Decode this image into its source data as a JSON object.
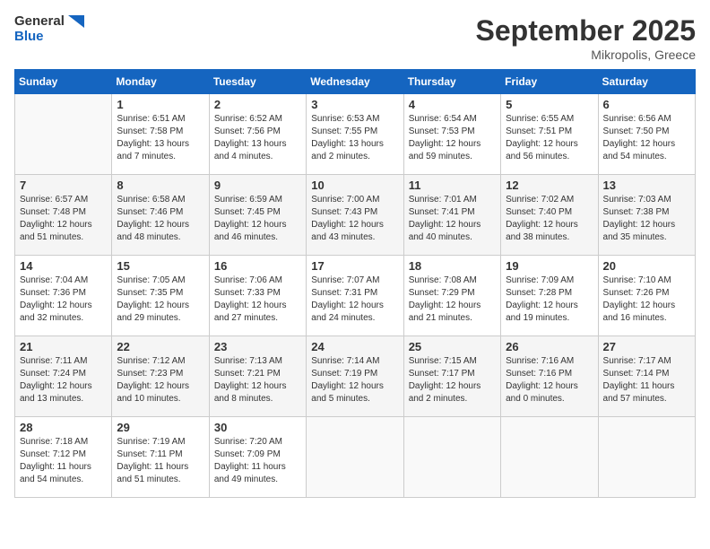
{
  "header": {
    "logo_line1": "General",
    "logo_line2": "Blue",
    "month": "September 2025",
    "location": "Mikropolis, Greece"
  },
  "days_of_week": [
    "Sunday",
    "Monday",
    "Tuesday",
    "Wednesday",
    "Thursday",
    "Friday",
    "Saturday"
  ],
  "weeks": [
    [
      {
        "day": "",
        "sunrise": "",
        "sunset": "",
        "daylight": ""
      },
      {
        "day": "1",
        "sunrise": "Sunrise: 6:51 AM",
        "sunset": "Sunset: 7:58 PM",
        "daylight": "Daylight: 13 hours and 7 minutes."
      },
      {
        "day": "2",
        "sunrise": "Sunrise: 6:52 AM",
        "sunset": "Sunset: 7:56 PM",
        "daylight": "Daylight: 13 hours and 4 minutes."
      },
      {
        "day": "3",
        "sunrise": "Sunrise: 6:53 AM",
        "sunset": "Sunset: 7:55 PM",
        "daylight": "Daylight: 13 hours and 2 minutes."
      },
      {
        "day": "4",
        "sunrise": "Sunrise: 6:54 AM",
        "sunset": "Sunset: 7:53 PM",
        "daylight": "Daylight: 12 hours and 59 minutes."
      },
      {
        "day": "5",
        "sunrise": "Sunrise: 6:55 AM",
        "sunset": "Sunset: 7:51 PM",
        "daylight": "Daylight: 12 hours and 56 minutes."
      },
      {
        "day": "6",
        "sunrise": "Sunrise: 6:56 AM",
        "sunset": "Sunset: 7:50 PM",
        "daylight": "Daylight: 12 hours and 54 minutes."
      }
    ],
    [
      {
        "day": "7",
        "sunrise": "Sunrise: 6:57 AM",
        "sunset": "Sunset: 7:48 PM",
        "daylight": "Daylight: 12 hours and 51 minutes."
      },
      {
        "day": "8",
        "sunrise": "Sunrise: 6:58 AM",
        "sunset": "Sunset: 7:46 PM",
        "daylight": "Daylight: 12 hours and 48 minutes."
      },
      {
        "day": "9",
        "sunrise": "Sunrise: 6:59 AM",
        "sunset": "Sunset: 7:45 PM",
        "daylight": "Daylight: 12 hours and 46 minutes."
      },
      {
        "day": "10",
        "sunrise": "Sunrise: 7:00 AM",
        "sunset": "Sunset: 7:43 PM",
        "daylight": "Daylight: 12 hours and 43 minutes."
      },
      {
        "day": "11",
        "sunrise": "Sunrise: 7:01 AM",
        "sunset": "Sunset: 7:41 PM",
        "daylight": "Daylight: 12 hours and 40 minutes."
      },
      {
        "day": "12",
        "sunrise": "Sunrise: 7:02 AM",
        "sunset": "Sunset: 7:40 PM",
        "daylight": "Daylight: 12 hours and 38 minutes."
      },
      {
        "day": "13",
        "sunrise": "Sunrise: 7:03 AM",
        "sunset": "Sunset: 7:38 PM",
        "daylight": "Daylight: 12 hours and 35 minutes."
      }
    ],
    [
      {
        "day": "14",
        "sunrise": "Sunrise: 7:04 AM",
        "sunset": "Sunset: 7:36 PM",
        "daylight": "Daylight: 12 hours and 32 minutes."
      },
      {
        "day": "15",
        "sunrise": "Sunrise: 7:05 AM",
        "sunset": "Sunset: 7:35 PM",
        "daylight": "Daylight: 12 hours and 29 minutes."
      },
      {
        "day": "16",
        "sunrise": "Sunrise: 7:06 AM",
        "sunset": "Sunset: 7:33 PM",
        "daylight": "Daylight: 12 hours and 27 minutes."
      },
      {
        "day": "17",
        "sunrise": "Sunrise: 7:07 AM",
        "sunset": "Sunset: 7:31 PM",
        "daylight": "Daylight: 12 hours and 24 minutes."
      },
      {
        "day": "18",
        "sunrise": "Sunrise: 7:08 AM",
        "sunset": "Sunset: 7:29 PM",
        "daylight": "Daylight: 12 hours and 21 minutes."
      },
      {
        "day": "19",
        "sunrise": "Sunrise: 7:09 AM",
        "sunset": "Sunset: 7:28 PM",
        "daylight": "Daylight: 12 hours and 19 minutes."
      },
      {
        "day": "20",
        "sunrise": "Sunrise: 7:10 AM",
        "sunset": "Sunset: 7:26 PM",
        "daylight": "Daylight: 12 hours and 16 minutes."
      }
    ],
    [
      {
        "day": "21",
        "sunrise": "Sunrise: 7:11 AM",
        "sunset": "Sunset: 7:24 PM",
        "daylight": "Daylight: 12 hours and 13 minutes."
      },
      {
        "day": "22",
        "sunrise": "Sunrise: 7:12 AM",
        "sunset": "Sunset: 7:23 PM",
        "daylight": "Daylight: 12 hours and 10 minutes."
      },
      {
        "day": "23",
        "sunrise": "Sunrise: 7:13 AM",
        "sunset": "Sunset: 7:21 PM",
        "daylight": "Daylight: 12 hours and 8 minutes."
      },
      {
        "day": "24",
        "sunrise": "Sunrise: 7:14 AM",
        "sunset": "Sunset: 7:19 PM",
        "daylight": "Daylight: 12 hours and 5 minutes."
      },
      {
        "day": "25",
        "sunrise": "Sunrise: 7:15 AM",
        "sunset": "Sunset: 7:17 PM",
        "daylight": "Daylight: 12 hours and 2 minutes."
      },
      {
        "day": "26",
        "sunrise": "Sunrise: 7:16 AM",
        "sunset": "Sunset: 7:16 PM",
        "daylight": "Daylight: 12 hours and 0 minutes."
      },
      {
        "day": "27",
        "sunrise": "Sunrise: 7:17 AM",
        "sunset": "Sunset: 7:14 PM",
        "daylight": "Daylight: 11 hours and 57 minutes."
      }
    ],
    [
      {
        "day": "28",
        "sunrise": "Sunrise: 7:18 AM",
        "sunset": "Sunset: 7:12 PM",
        "daylight": "Daylight: 11 hours and 54 minutes."
      },
      {
        "day": "29",
        "sunrise": "Sunrise: 7:19 AM",
        "sunset": "Sunset: 7:11 PM",
        "daylight": "Daylight: 11 hours and 51 minutes."
      },
      {
        "day": "30",
        "sunrise": "Sunrise: 7:20 AM",
        "sunset": "Sunset: 7:09 PM",
        "daylight": "Daylight: 11 hours and 49 minutes."
      },
      {
        "day": "",
        "sunrise": "",
        "sunset": "",
        "daylight": ""
      },
      {
        "day": "",
        "sunrise": "",
        "sunset": "",
        "daylight": ""
      },
      {
        "day": "",
        "sunrise": "",
        "sunset": "",
        "daylight": ""
      },
      {
        "day": "",
        "sunrise": "",
        "sunset": "",
        "daylight": ""
      }
    ]
  ]
}
